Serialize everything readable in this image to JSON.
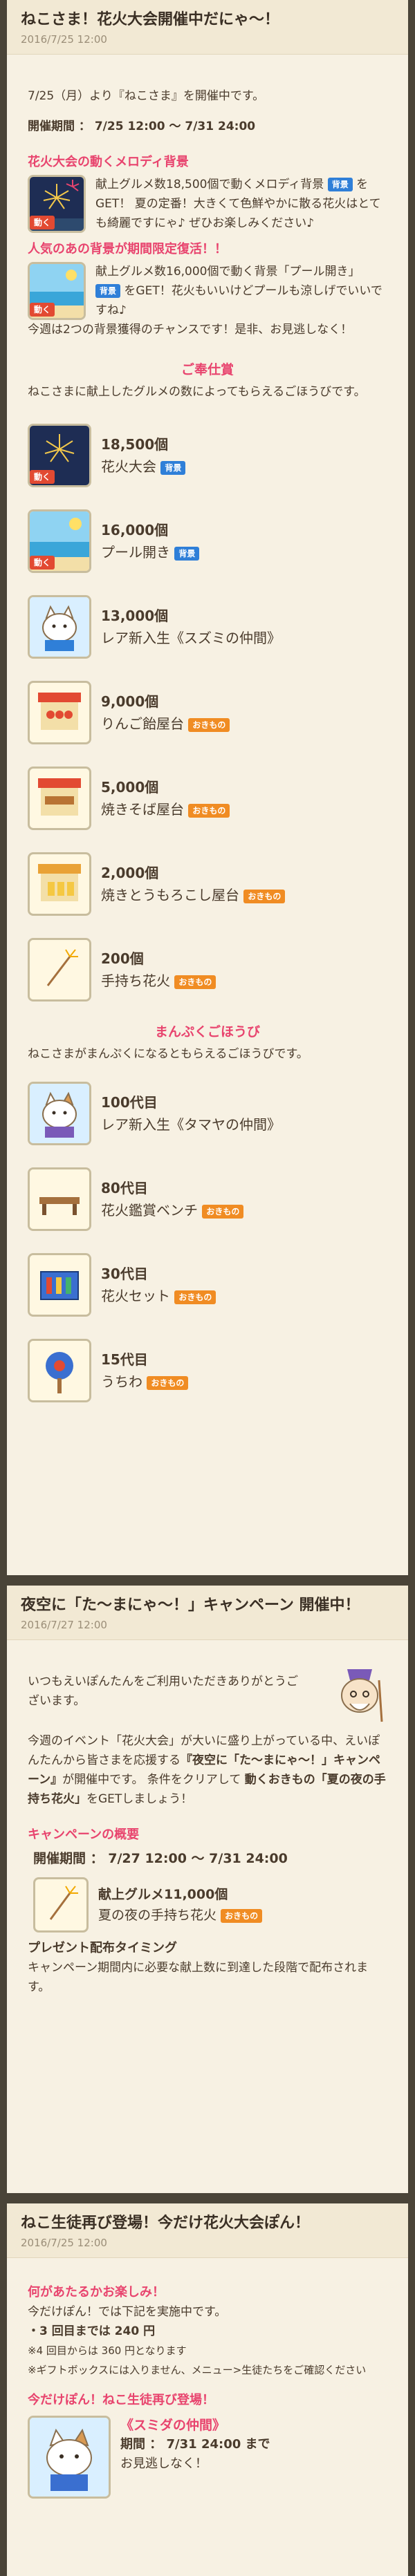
{
  "card1": {
    "title": "ねこさま！花火大会開催中だにゃ〜！",
    "date": "2016/7/25 12:00",
    "intro": "7/25（月）より『ねこさま』を開催中です。",
    "period_label": "開催期間 ： 7/25 12:00 〜 7/31 24:00",
    "melody_heading": "花火大会の動くメロディ背景",
    "melody_text_a": "献上グルメ数18,500個で動くメロディ背景",
    "melody_badge": "背景",
    "melody_text_b": "をGET！ 夏の定番！大きくて色鮮やかに散る花火はとても綺麗ですにゃ♪ ぜひお楽しみください♪",
    "revival_heading": "人気のあの背景が期間限定復活！！",
    "revival_text_a": "献上グルメ数16,000個で動く背景「プール開き」",
    "revival_badge": "背景",
    "revival_text_b": "をGET！花火もいいけどプールも涼しげでいいですね♪",
    "revival_text_c": "今週は2つの背景獲得のチャンスです！是非、お見逃しなく！",
    "tag_label": "動く",
    "reward_heading": "ご奉仕賞",
    "reward_desc": "ねこさまに献上したグルメの数によってもらえるごほうびです。",
    "rewards": [
      {
        "qty": "18,500個",
        "name": "花火大会",
        "badge": "背景"
      },
      {
        "qty": "16,000個",
        "name": "プール開き",
        "badge": "背景"
      },
      {
        "qty": "13,000個",
        "name": "レア新入生《スズミの仲間》",
        "badge": ""
      },
      {
        "qty": "9,000個",
        "name": "りんご飴屋台",
        "badge": "おきもの"
      },
      {
        "qty": "5,000個",
        "name": "焼きそば屋台",
        "badge": "おきもの"
      },
      {
        "qty": "2,000個",
        "name": "焼きとうもろこし屋台",
        "badge": "おきもの"
      },
      {
        "qty": "200個",
        "name": "手持ち花火",
        "badge": "おきもの"
      }
    ],
    "fullness_heading": "まんぷくごほうび",
    "fullness_desc": "ねこさまがまんぷくになるともらえるごほうびです。",
    "fullness": [
      {
        "qty": "100代目",
        "name": "レア新入生《タマヤの仲間》",
        "badge": ""
      },
      {
        "qty": "80代目",
        "name": "花火鑑賞ベンチ",
        "badge": "おきもの"
      },
      {
        "qty": "30代目",
        "name": "花火セット",
        "badge": "おきもの"
      },
      {
        "qty": "15代目",
        "name": "うちわ",
        "badge": "おきもの"
      }
    ]
  },
  "card2": {
    "title": "夜空に「た〜まにゃ〜！」キャンペーン 開催中！",
    "date": "2016/7/27 12:00",
    "greeting": "いつもえいぽんたんをご利用いただきありがとうございます。",
    "body_a": "今週のイベント「花火大会」が大いに盛り上がっている中、えいぽんたんから皆さまを応援する",
    "campaign_name": "『夜空に「た〜まにゃ〜！」キャンペーン』",
    "body_b": "が開催中です。 条件をクリアして",
    "reward_bold": "動くおきもの「夏の夜の手持ち花火」",
    "body_c": "をGETしましょう！",
    "overview_heading": "キャンペーンの概要",
    "period_label": "開催期間 ： 7/27 12:00 〜 7/31 24:00",
    "item_qty": "献上グルメ11,000個",
    "item_name": "夏の夜の手持ち花火",
    "item_badge": "おきもの",
    "timing_heading": "プレゼント配布タイミング",
    "timing_text": "キャンペーン期間内に必要な献上数に到達した段階で配布されます。"
  },
  "card3": {
    "title": "ねこ生徒再び登場！今だけ花火大会ぽん！",
    "date": "2016/7/25 12:00",
    "heading1": "何があたるかお楽しみ！",
    "line1": "今だけぽん！では下記を実施中です。",
    "line2": "・3 回目までは 240 円",
    "line3": "※4 回目からは 360 円となります",
    "line4": "※ギフトボックスには入りません、メニュー>生徒たちをご確認ください",
    "heading2": "今だけぽん！ねこ生徒再び登場！",
    "char_name": "《スミダの仲間》",
    "char_period": "期間 ： 7/31 24:00 まで",
    "char_note": "お見逃しなく！"
  },
  "colors": {
    "accent_pink": "#e8446e",
    "badge_blue": "#2f7fd8",
    "badge_orange": "#f08c23",
    "background": "#4a4438",
    "card": "#f7f1e3"
  }
}
